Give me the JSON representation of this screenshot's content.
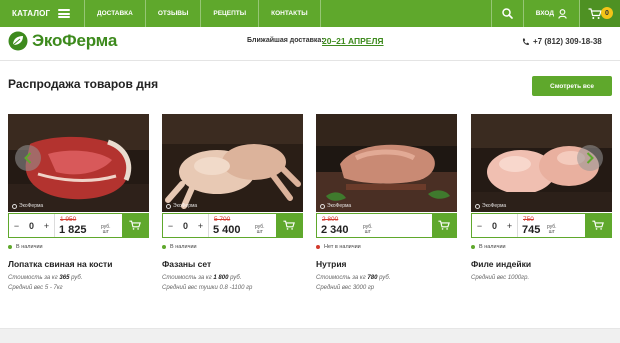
{
  "nav": {
    "catalog": "КАТАЛОГ",
    "items": [
      "ДОСТАВКА",
      "ОТЗЫВЫ",
      "РЕЦЕПТЫ",
      "КОНТАКТЫ"
    ],
    "login": "ВХОД",
    "cart_count": "0"
  },
  "header": {
    "logo": "ЭкоФерма",
    "delivery_label": "Ближайшая доставка:",
    "delivery_date": "20–21 АПРЕЛЯ",
    "phone": "+7 (812) 309-18-38"
  },
  "section": {
    "title": "Распродажа товаров дня",
    "see_all": "Смотреть все"
  },
  "watermark": "ЭкоФерма",
  "unit_rub": "руб.",
  "unit_sht": "шт",
  "colors": {
    "brand": "#5fa82c",
    "in_stock": "#5fa82c",
    "out_of_stock": "#d23a2d",
    "old_price": "#d23a2d"
  },
  "products": [
    {
      "name": "Лопатка свиная на кости",
      "qty": "0",
      "old_price": "1 950",
      "price": "1 825",
      "stock": "В наличии",
      "in_stock": true,
      "meta1_pre": "Стоимость за кг ",
      "meta1_val": "365",
      "meta1_post": " руб.",
      "meta2": "Средний вес 5 - 7кг"
    },
    {
      "name": "Фазаны сет",
      "qty": "0",
      "old_price": "5 700",
      "price": "5 400",
      "stock": "В наличии",
      "in_stock": true,
      "meta1_pre": "Стоимость за кг ",
      "meta1_val": "1 800",
      "meta1_post": " руб.",
      "meta2": "Средний вес тушки 0.8 -1100 гр"
    },
    {
      "name": "Нутрия",
      "qty": "0",
      "old_price": "2 800",
      "price": "2 340",
      "stock": "Нет в наличии",
      "in_stock": false,
      "meta1_pre": "Стоимость за кг ",
      "meta1_val": "780",
      "meta1_post": " руб.",
      "meta2": "Средний вес 3000 гр"
    },
    {
      "name": "Филе индейки",
      "qty": "0",
      "old_price": "750",
      "price": "745",
      "stock": "В наличии",
      "in_stock": true,
      "meta1_pre": "",
      "meta1_val": "",
      "meta1_post": "",
      "meta2": "Средний вес 1000гр."
    }
  ]
}
